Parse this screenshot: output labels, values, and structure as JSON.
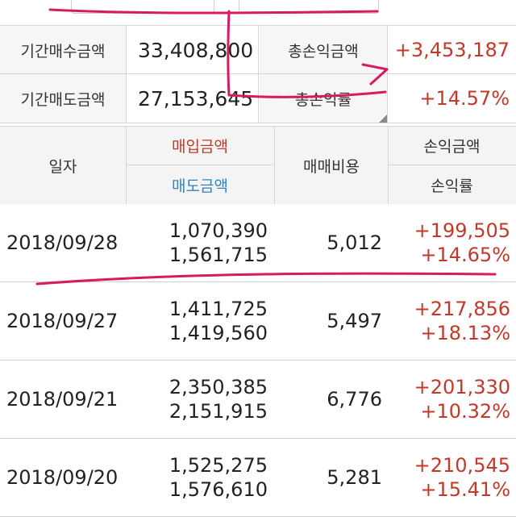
{
  "summary": {
    "buy_total_label": "기간매수금액",
    "buy_total_value": "33,408,800",
    "total_pl_label": "총손익금액",
    "total_pl_value": "+3,453,187",
    "sell_total_label": "기간매도금액",
    "sell_total_value": "27,153,645",
    "total_rate_label": "총손익률",
    "total_rate_value": "+14.57%"
  },
  "header": {
    "date": "일자",
    "buy_amount": "매입금액",
    "sell_amount": "매도금액",
    "fee": "매매비용",
    "pl_amount": "손익금액",
    "pl_rate": "손익률"
  },
  "rows": [
    {
      "date": "2018/09/28",
      "buy": "1,070,390",
      "sell": "1,561,715",
      "fee": "5,012",
      "pl": "+199,505",
      "rate": "+14.65%"
    },
    {
      "date": "2018/09/27",
      "buy": "1,411,725",
      "sell": "1,419,560",
      "fee": "5,497",
      "pl": "+217,856",
      "rate": "+18.13%"
    },
    {
      "date": "2018/09/21",
      "buy": "2,350,385",
      "sell": "2,151,915",
      "fee": "6,776",
      "pl": "+201,330",
      "rate": "+10.32%"
    },
    {
      "date": "2018/09/20",
      "buy": "1,525,275",
      "sell": "1,576,610",
      "fee": "5,281",
      "pl": "+210,545",
      "rate": "+15.41%"
    }
  ],
  "colors": {
    "profit": "#c0392b",
    "buy_header": "#c0392b",
    "sell_header": "#2e86c1",
    "annotation": "#d81b60"
  }
}
